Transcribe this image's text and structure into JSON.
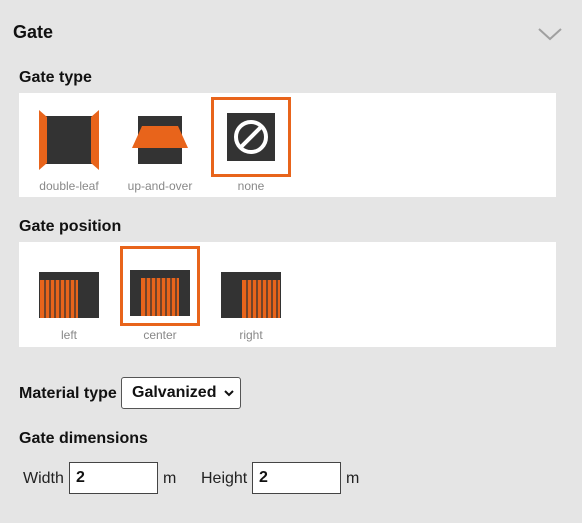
{
  "panel": {
    "title": "Gate"
  },
  "gate_type": {
    "label": "Gate type",
    "options": [
      {
        "label": "double-leaf",
        "selected": false
      },
      {
        "label": "up-and-over",
        "selected": false
      },
      {
        "label": "none",
        "selected": true
      }
    ]
  },
  "gate_position": {
    "label": "Gate position",
    "options": [
      {
        "label": "left",
        "selected": false
      },
      {
        "label": "center",
        "selected": true
      },
      {
        "label": "right",
        "selected": false
      }
    ]
  },
  "material": {
    "label": "Material type",
    "value": "Galvanized"
  },
  "dimensions": {
    "label": "Gate dimensions",
    "width_label": "Width",
    "width_value": "2",
    "width_unit": "m",
    "height_label": "Height",
    "height_value": "2",
    "height_unit": "m"
  },
  "colors": {
    "accent": "#e8641b",
    "dark": "#333333",
    "label_gray": "#888888"
  }
}
